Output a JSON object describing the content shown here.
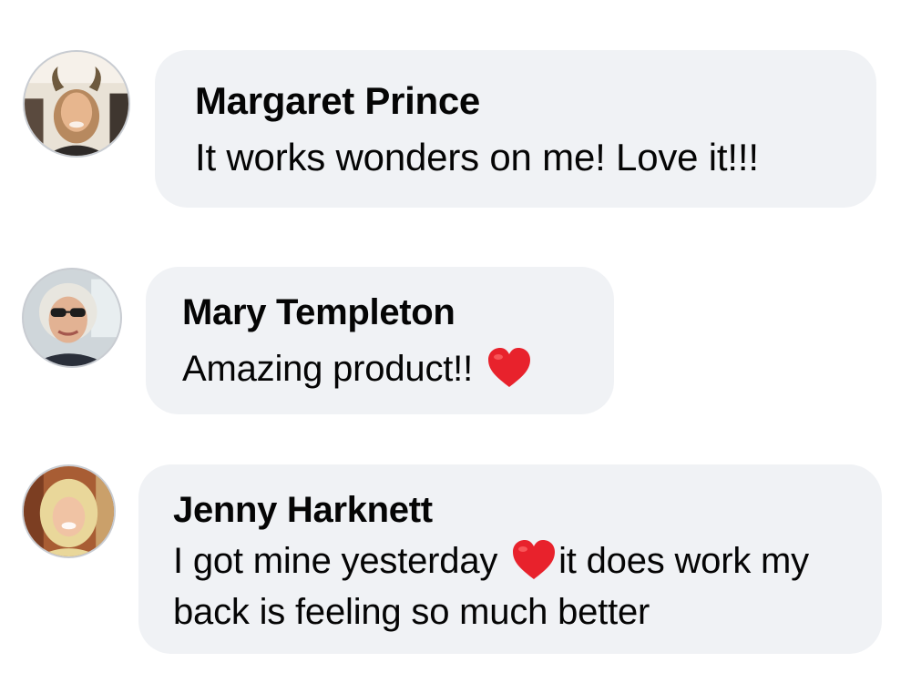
{
  "comments": [
    {
      "author": "Margaret Prince",
      "text_before": "It works wonders on me! Love it!!!",
      "text_after": "",
      "avatar": "user-photo-woman-horns"
    },
    {
      "author": "Mary Templeton",
      "text_before": "Amazing product!!",
      "text_after": "",
      "emoji": "red-heart",
      "avatar": "user-photo-woman-sunglasses"
    },
    {
      "author": "Jenny Harknett",
      "text_before": "I got mine yesterday",
      "text_after": "it does work my back is feeling so much better",
      "emoji": "red-heart",
      "avatar": "user-photo-woman-blonde"
    }
  ],
  "colors": {
    "bubble_bg": "#f0f2f5",
    "text": "#050505",
    "heart": "#e8222c",
    "avatar_border": "#c8ccd2"
  }
}
